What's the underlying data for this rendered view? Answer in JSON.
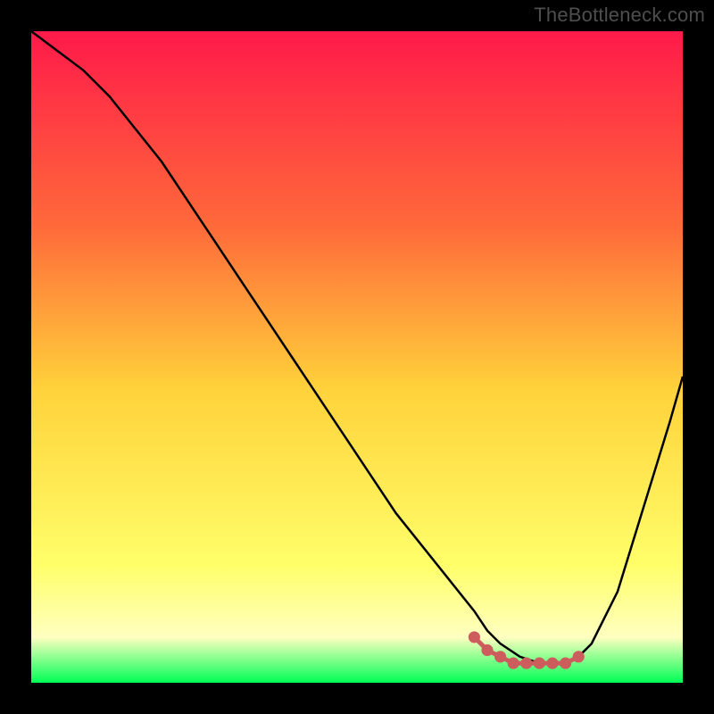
{
  "watermark": "TheBottleneck.com",
  "colors": {
    "black": "#000000",
    "curve": "#000000",
    "marker": "#cd5c5c",
    "grad_top": "#ff1a4a",
    "grad_mid_upper": "#ff6a3a",
    "grad_mid": "#ffd23a",
    "grad_mid_lower": "#ffff6a",
    "grad_low": "#ffffc0",
    "grad_bottom": "#00ff55"
  },
  "chart_data": {
    "type": "line",
    "title": "",
    "xlabel": "",
    "ylabel": "",
    "xlim": [
      0,
      100
    ],
    "ylim": [
      0,
      100
    ],
    "series": [
      {
        "name": "bottleneck-curve",
        "x": [
          0,
          4,
          8,
          12,
          16,
          20,
          24,
          28,
          32,
          36,
          40,
          44,
          48,
          52,
          56,
          60,
          64,
          68,
          70,
          72,
          75,
          78,
          80,
          82,
          84,
          86,
          90,
          94,
          98,
          100
        ],
        "y": [
          100,
          97,
          94,
          90,
          85,
          80,
          74,
          68,
          62,
          56,
          50,
          44,
          38,
          32,
          26,
          21,
          16,
          11,
          8,
          6,
          4,
          3,
          3,
          3,
          4,
          6,
          14,
          27,
          40,
          47
        ]
      }
    ],
    "optimal_marker": {
      "name": "optimal-range",
      "x": [
        68,
        70,
        72,
        74,
        76,
        78,
        80,
        82,
        84
      ],
      "y": [
        7,
        5,
        4,
        3,
        3,
        3,
        3,
        3,
        4
      ]
    }
  }
}
